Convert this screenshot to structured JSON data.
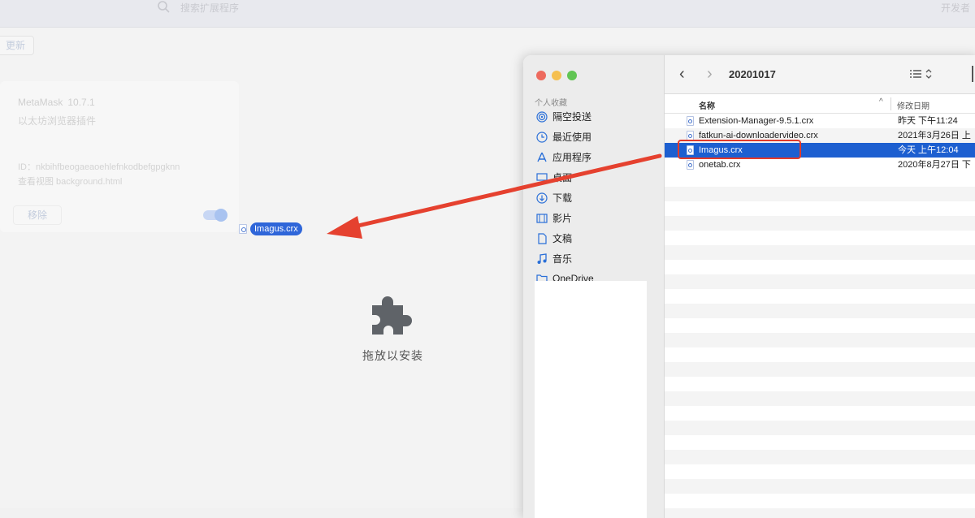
{
  "extensions_page": {
    "search_placeholder": "搜索扩展程序",
    "developer_mode_label": "开发者",
    "update_button": "更新",
    "card": {
      "name": "MetaMask",
      "version": "10.7.1",
      "description": "以太坊浏览器插件",
      "id_line": "ID：nkbihfbeogaeaoehlefnkodbefgpgknn",
      "inspect_views": "查看视图 background.html",
      "remove_button": "移除",
      "enabled": true
    },
    "drag_ghost_label": "Imagus.crx",
    "drop_hint": "拖放以安装",
    "annotation_color": "#e5412f"
  },
  "finder": {
    "sidebar": {
      "section_title": "个人收藏",
      "items": [
        {
          "label": "隔空投送",
          "icon": "airdrop-icon"
        },
        {
          "label": "最近使用",
          "icon": "clock-icon"
        },
        {
          "label": "应用程序",
          "icon": "applications-icon"
        },
        {
          "label": "桌面",
          "icon": "desktop-icon"
        },
        {
          "label": "下载",
          "icon": "download-icon"
        },
        {
          "label": "影片",
          "icon": "film-icon"
        },
        {
          "label": "文稿",
          "icon": "document-icon"
        },
        {
          "label": "音乐",
          "icon": "music-icon"
        },
        {
          "label": "OneDrive",
          "icon": "folder-icon"
        }
      ]
    },
    "toolbar": {
      "folder_title": "20201017"
    },
    "columns": {
      "name": "名称",
      "date_modified": "修改日期"
    },
    "files": [
      {
        "name": "Extension-Manager-9.5.1.crx",
        "date": "昨天 下午11:24",
        "selected": false
      },
      {
        "name": "fatkun-ai-downloadervideo.crx",
        "date": "2021年3月26日 上",
        "selected": false
      },
      {
        "name": "Imagus.crx",
        "date": "今天 上午12:04",
        "selected": true
      },
      {
        "name": "onetab.crx",
        "date": "2020年8月27日 下",
        "selected": false
      }
    ],
    "selection_color": "#1d5fd0"
  }
}
